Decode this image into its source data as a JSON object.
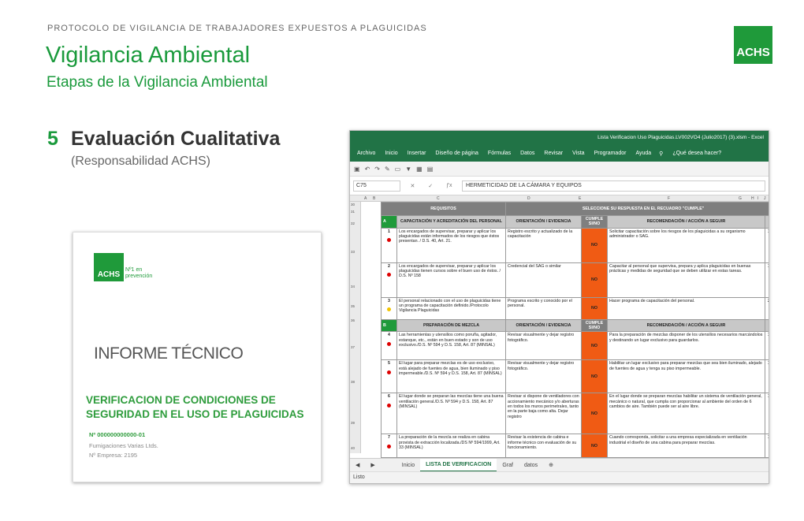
{
  "header": {
    "top_label": "PROTOCOLO DE VIGILANCIA DE TRABAJADORES EXPUESTOS A PLAGUICIDAS",
    "title": "Vigilancia Ambiental",
    "subtitle": "Etapas de la Vigilancia Ambiental",
    "logo": "ACHS"
  },
  "step": {
    "number": "5",
    "title": "Evaluación Cualitativa",
    "subtitle": "(Responsabilidad ACHS)"
  },
  "report": {
    "logo": "ACHS",
    "tagline": "Nº1 en prevención",
    "doc_type": "INFORME TÉCNICO",
    "heading": "VERIFICACION DE CONDICIONES DE SEGURIDAD EN EL USO DE PLAGUICIDAS",
    "number": "Nº 000000000000-01",
    "company": "Fumigaciones Varias Ltds.",
    "employees": "Nº Empresa: 2195"
  },
  "excel": {
    "window_title": "Lista Verificacion Uso Plaguicidas.LV002VO4 (Julio2017) (3).xlsm - Excel",
    "menu": [
      "Archivo",
      "Inicio",
      "Insertar",
      "Diseño de página",
      "Fórmulas",
      "Datos",
      "Revisar",
      "Vista",
      "Programador",
      "Ayuda"
    ],
    "search_placeholder": "¿Qué desea hacer?",
    "name_box": "C75",
    "formula": "HERMETICIDAD DE LA CÁMARA Y EQUIPOS",
    "columns": [
      "A",
      "B",
      "C",
      "D",
      "E",
      "F",
      "G",
      "H",
      "I",
      "J"
    ],
    "rows": [
      "30",
      "31",
      "32",
      "33",
      "34",
      "35",
      "36",
      "37",
      "38",
      "39",
      "40"
    ],
    "table": {
      "req_header": "REQUISITOS",
      "resp_header": "SELECCIONE SU RESPUESTA EN EL RECUADRO \"CUMPLE\"",
      "sections": [
        {
          "letter": "A",
          "title": "CAPACITACIÓN Y ACREDITACIÓN DEL PERSONAL",
          "orient": "ORIENTACIÓN / EVIDENCIA",
          "cumple": "CUMPLE SI/NO",
          "rec": "RECOMENDACIÓN / ACCIÓN A SEGUIR",
          "items": [
            {
              "n": "1",
              "dot": "red",
              "req": "Los encargados de supervisar, preparar y aplicar los plaguicidas están informados de los riesgos que éstos presentan. / D.S. 40, Art. 21.",
              "ev": "Registro escrito y actualizado de la capacitación",
              "ans": "NO",
              "rec": "Solicitar capacitación sobre los riesgos de los plaguicidas a su organismo administrador o SAG.",
              "s1": "1",
              "s2": "1"
            },
            {
              "n": "2",
              "dot": "red",
              "req": "Los encargados de supervisar, preparar y aplicar los plaguicidas tienen cursos sobre el buen uso de éstos. / D.S. Nº 158",
              "ev": "Credencial del SAG o similar",
              "ans": "NO",
              "rec": "Capacitar al personal que supervisa, prepara y aplica plaguicidas en buenas prácticas y medidas de seguridad que se deben utilizar en estas tareas.",
              "s1": "1",
              "s2": "1"
            },
            {
              "n": "3",
              "dot": "yel",
              "req": "El personal relacionado con el uso de plaguicidas tiene un programa de capacitación definido./Protocolo Vigilancia Plaguicidas",
              "ev": "Programa escrito y conocido por el personal.",
              "ans": "NO",
              "rec": "Hacer programa de capacitación del personal.",
              "s1": "2",
              "s2": "2"
            }
          ]
        },
        {
          "letter": "B",
          "title": "PREPARACIÓN DE MEZCLA",
          "orient": "ORIENTACIÓN / EVIDENCIA",
          "cumple": "CUMPLE SI/NO",
          "rec": "RECOMENDACIÓN / ACCIÓN A SEGUIR",
          "items": [
            {
              "n": "4",
              "dot": "red",
              "req": "Las herramientas y utensilios como poruña, agitador, estanque, etc., están en buen estado y son de uso exclusivo./D.S. Nº 594 y D.S. 158, Art. 87 (MINSAL)",
              "ev": "Revisar visualmente y dejar registro fotográfico.",
              "ans": "NO",
              "rec": "Para la preparación de mezclas disponer de los utensilios necesarios marcándolos y destinando un lugar exclusivo para guardarlos.",
              "s1": "1",
              "s2": "1"
            },
            {
              "n": "5",
              "dot": "red",
              "req": "El lugar para preparar mezclas es de uso exclusivo, está alejado de fuentes de agua, bien iluminado y piso impermeable./D.S. Nº 594 y D.S. 158, Art. 87 (MINSAL)",
              "ev": "Revisar visualmente y dejar registro fotográfico.",
              "ans": "NO",
              "rec": "Habilitar un lugar exclusivo para preparar mezclas que sea bien iluminado, alejado de fuentes de agua y tenga su piso impermeable.",
              "s1": "1",
              "s2": "1"
            },
            {
              "n": "6",
              "dot": "red",
              "req": "El lugar donde se preparan las mezclas tiene una buena ventilación general./D.S. Nº 594 y D.S. 158, Art. 87 (MINSAL)",
              "ev": "Revisar si dispone de ventiladores con accionamiento mecánico y/o aberturas en todos los muros perimetrales, tanto en la parte baja como alta. Dejar registro",
              "ans": "NO",
              "rec": "En el lugar donde se preparan mezclas habilitar un sistema de ventilación general, mecánico o natural, que cumpla con proporcionar al ambiente del orden de 6 cambios de aire. También puede ser al aire libre.",
              "s1": "1",
              "s2": "1"
            },
            {
              "n": "7",
              "dot": "red",
              "req": "La preparación de la mezcla se realiza en cabina provista de extracción localizada./DS Nº 594/1999, Art. 33 (MINSAL)",
              "ev": "Revisar la existencia de cabina e informe técnico con evaluación de su funcionamiento.",
              "ans": "NO",
              "rec": "Cuando corresponda, solicitar a una empresa especializada en ventilación industrial el diseño de una cabina para preparar mezclas.",
              "s1": "1",
              "s2": "1"
            }
          ]
        }
      ]
    },
    "sheet_tabs": [
      "Inicio",
      "LISTA DE VERIFICACION",
      "Graf",
      "datos"
    ],
    "status": "Listo"
  }
}
